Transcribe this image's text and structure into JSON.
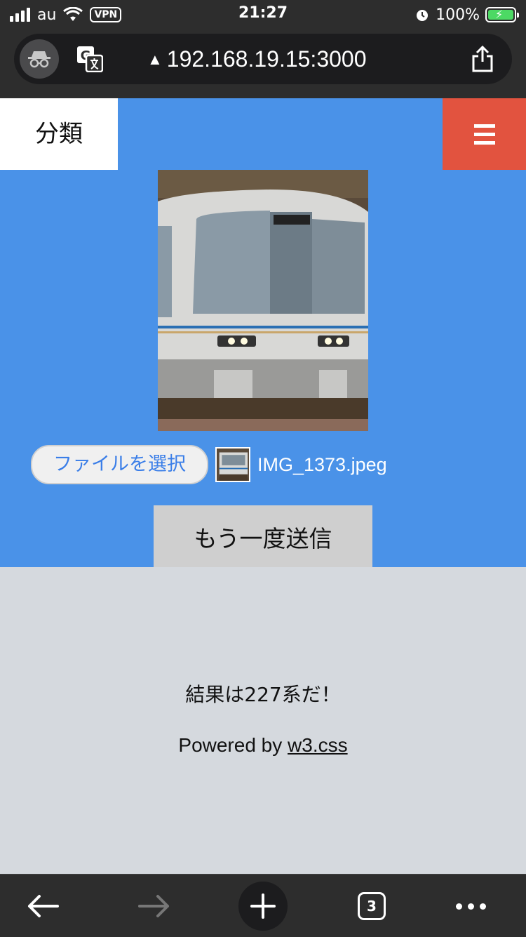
{
  "status_bar": {
    "carrier": "au",
    "vpn_label": "VPN",
    "time": "21:27",
    "battery": "100%",
    "battery_level": 1.0
  },
  "browser": {
    "url": "192.168.19.15:3000",
    "icons": {
      "incognito": "incognito-icon",
      "translate": "translate-icon",
      "share": "share-icon",
      "warning": "warning-icon"
    },
    "bottom_toolbar": {
      "tab_count": "3"
    }
  },
  "nav": {
    "title": "分類",
    "menu_icon": "hamburger-icon"
  },
  "main": {
    "file_button_label": "ファイルを選択",
    "file_name": "IMG_1373.jpeg",
    "resubmit_label": "もう一度送信",
    "result_text": "結果は227系だ！",
    "powered_prefix": "Powered by ",
    "powered_link": "w3.css"
  },
  "colors": {
    "nav_background": "#4a92e8",
    "menu_button": "#e2533f",
    "page_background": "#d5d9de"
  }
}
